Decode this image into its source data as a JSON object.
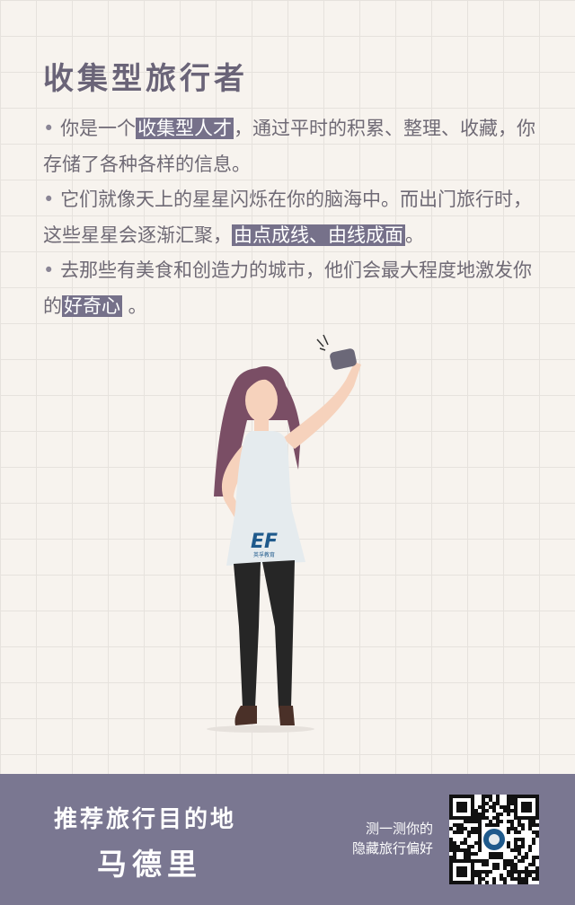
{
  "title": "收集型旅行者",
  "paragraphs": [
    [
      {
        "t": "• ",
        "hl": false,
        "bullet": true
      },
      {
        "t": "你是一个",
        "hl": false
      },
      {
        "t": "收集型人才",
        "hl": true
      },
      {
        "t": "，通过平时的积累、整理、收藏，你存储了各种各样的信息。",
        "hl": false
      }
    ],
    [
      {
        "t": "• ",
        "hl": false,
        "bullet": true
      },
      {
        "t": "它们就像天上的星星闪烁在你的脑海中。而出门旅行时，这些星星会逐渐汇聚，",
        "hl": false
      },
      {
        "t": "由点成线、由线成面",
        "hl": true
      },
      {
        "t": "。",
        "hl": false
      }
    ],
    [
      {
        "t": "• ",
        "hl": false,
        "bullet": true
      },
      {
        "t": "去那些有美食和创造力的城市，他们会最大程度地激发你的",
        "hl": false
      },
      {
        "t": "好奇心",
        "hl": true
      },
      {
        "t": " 。",
        "hl": false
      }
    ]
  ],
  "illustration": {
    "logo_text": "EF",
    "logo_caption": "英孚教育",
    "colors": {
      "hair": "#7a4e65",
      "skin": "#f6d2bc",
      "top": "#e5ebee",
      "pants": "#262626",
      "shoes": "#4a3028",
      "phone": "#6b6878",
      "logo": "#1f5a8c"
    }
  },
  "footer": {
    "line1": "推荐旅行目的地",
    "line2": "马德里",
    "cta_line1": "测一测你的",
    "cta_line2": "隐藏旅行偏好",
    "qr_icon": "qr-code-icon"
  },
  "colors": {
    "background": "#f7f3ee",
    "grid": "#e6e2dd",
    "highlight": "#76718a",
    "text": "#6f6a75",
    "title": "#6a6478",
    "footer_bg": "#7a7791"
  }
}
